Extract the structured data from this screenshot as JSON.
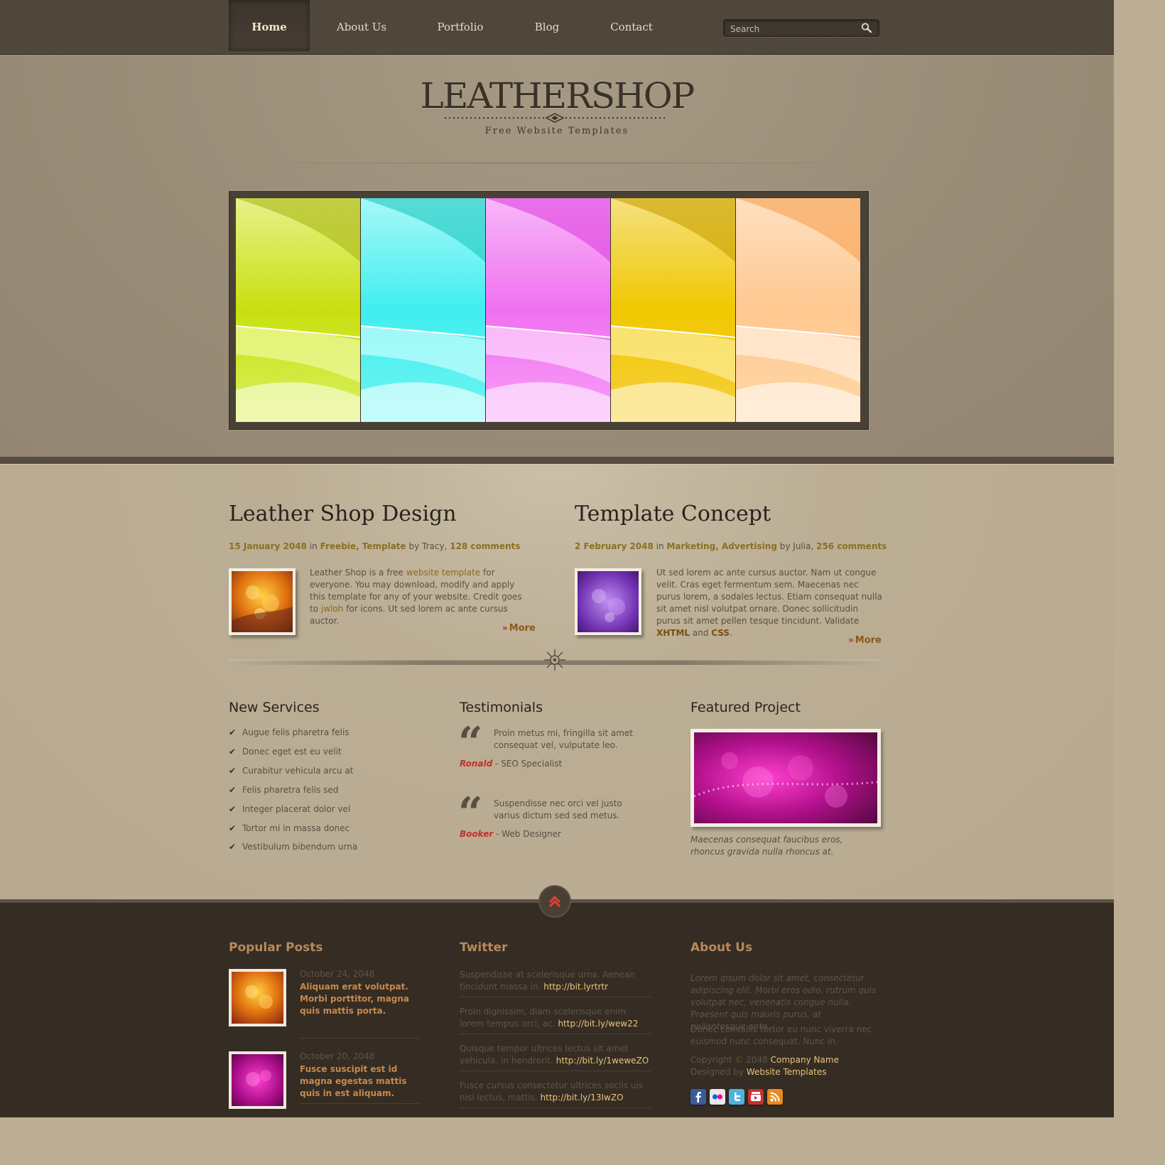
{
  "nav": {
    "items": [
      {
        "label": "Home",
        "active": true
      },
      {
        "label": "About Us"
      },
      {
        "label": "Portfolio"
      },
      {
        "label": "Blog"
      },
      {
        "label": "Contact"
      }
    ],
    "search_placeholder": "Search",
    "search_icon": "magnifier-icon"
  },
  "logo": {
    "title": "LEATHERSHOP",
    "subtitle": "Free Website Templates"
  },
  "slider": {
    "slides": [
      {
        "name": "lime",
        "color": "#c8e01a"
      },
      {
        "name": "cyan",
        "color": "#40f0f0"
      },
      {
        "name": "magenta",
        "color": "#f080f0"
      },
      {
        "name": "yellow",
        "color": "#f0c800"
      },
      {
        "name": "peach",
        "color": "#ffc890"
      }
    ]
  },
  "posts": [
    {
      "title": "Leather Shop Design",
      "date": "15 January 2048",
      "in": "in",
      "categories": "Freebie, Template",
      "by": "by Tracy,",
      "comments": "128 comments",
      "body_1": "Leather Shop is a free ",
      "body_link1": "website template",
      "body_2": " for everyone. You may download, modify and apply this template for any of your website. Credit goes to ",
      "body_link2": "jwloh",
      "body_3": " for icons. Ut sed lorem ac ante cursus auctor.",
      "more": "More"
    },
    {
      "title": "Template Concept",
      "date": "2 February 2048",
      "in": "in",
      "categories": "Marketing, Advertising",
      "by": "by Julia,",
      "comments": "256 comments",
      "body_1": "Ut sed lorem ac ante cursus auctor. Nam ut congue velit. Cras eget fermentum sem. Maecenas nec purus lorem, a sodales lectus. Etiam consequat nulla sit amet nisl volutpat ornare. Donec sollicitudin purus sit amet pellen tesque tincidunt. Validate ",
      "body_link1": "XHTML",
      "body_2": " and ",
      "body_link2": "CSS",
      "body_3": ".",
      "more": "More"
    }
  ],
  "services": {
    "title": "New Services",
    "items": [
      "Augue felis pharetra felis",
      "Donec eget est eu velit",
      "Curabitur vehicula arcu at",
      "Felis pharetra felis sed",
      "Integer placerat dolor vel",
      "Tortor mi in massa donec",
      "Vestibulum bibendum urna"
    ]
  },
  "testimonials": {
    "title": "Testimonials",
    "items": [
      {
        "text": "Proin metus mi, fringilla sit amet consequat vel, vulputate leo.",
        "name": "Ronald",
        "role": "- SEO Specialist"
      },
      {
        "text": "Suspendisse nec orci vel justo varius dictum sed sed metus.",
        "name": "Booker",
        "role": "- Web Designer"
      }
    ]
  },
  "featured": {
    "title": "Featured Project",
    "caption": "Maecenas consequat faucibus eros, rhoncus gravida nulla rhoncus at."
  },
  "footer": {
    "popular": {
      "title": "Popular Posts",
      "items": [
        {
          "date": "October 24, 2048",
          "title": "Aliquam erat volutpat. Morbi porttitor, magna quis mattis porta."
        },
        {
          "date": "October 20, 2048",
          "title": "Fusce suscipit est id magna egestas mattis quis in est aliquam."
        }
      ]
    },
    "twitter": {
      "title": "Twitter",
      "items": [
        {
          "text": "Suspendisse at scelerisque urna. Aenean tincidunt massa in. ",
          "link": "http://bit.lyrtrtr"
        },
        {
          "text": "Proin dignissim, diam scelerisque enim lorem tempus orci, ac. ",
          "link": "http://bit.ly/wew22"
        },
        {
          "text": "Quisque tempor ultrices lectus sit amet vehicula. In hendrerit. ",
          "link": "http://bit.ly/1weweZO"
        },
        {
          "text": "Fusce cursus consectetur ultrices sociis uis nisl lectus, mattis. ",
          "link": "http://bit.ly/13IwZO"
        }
      ]
    },
    "about": {
      "title": "About Us",
      "text1": "Lorem ipsum dolor sit amet, consectetur adipiscing elit. Morbi eros odio, rutrum quis volutpat nec, venenatis congue nulla. Praesent quis mauris purus, at pellentesque ante.",
      "text2": "Donec convallis tortor eu nunc viverra nec euismod nunc consequat. Nunc in.",
      "copyright": "Copyright © 2048",
      "company": "Company Name",
      "designed_by": "Designed by",
      "designer": "Website Templates"
    },
    "social": [
      {
        "icon": "facebook-icon",
        "color": "#3b5b9a"
      },
      {
        "icon": "flickr-icon",
        "color": "#e8e8ee"
      },
      {
        "icon": "twitter-icon",
        "color": "#4fb3d9"
      },
      {
        "icon": "youtube-icon",
        "color": "#c8302a"
      },
      {
        "icon": "rss-icon",
        "color": "#e88a20"
      }
    ]
  }
}
